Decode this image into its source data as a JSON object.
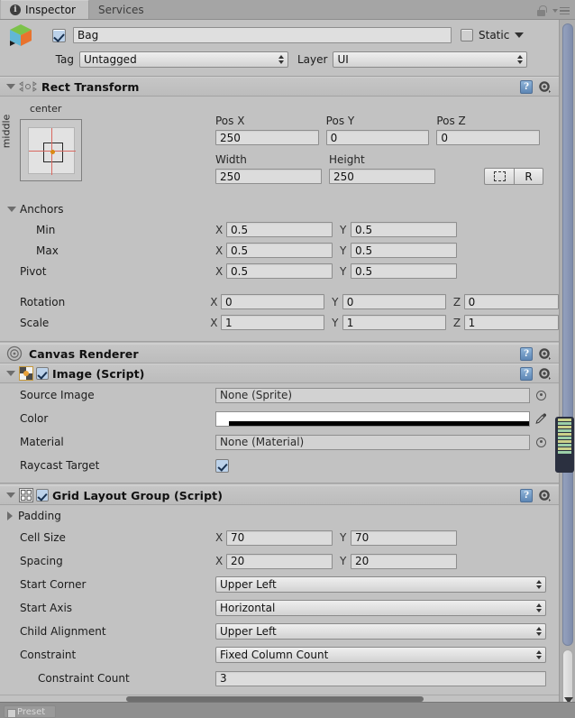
{
  "window": {
    "tabs": [
      {
        "label": "Inspector",
        "icon": "info-icon",
        "active": true
      },
      {
        "label": "Services",
        "icon": "",
        "active": false
      }
    ],
    "lock_icon": "lock-icon",
    "menu_icon": "hamburger-menu-icon"
  },
  "gameobject": {
    "icon": "gameobject-cube-icon",
    "enabled": true,
    "name": "Bag",
    "static_checked": false,
    "static_label": "Static",
    "tag_label": "Tag",
    "tag_value": "Untagged",
    "layer_label": "Layer",
    "layer_value": "UI"
  },
  "rect_transform": {
    "title": "Rect Transform",
    "icon": "rect-transform-icon",
    "expanded": true,
    "anchor_preset_h": "center",
    "anchor_preset_v": "middle",
    "pos_x_label": "Pos X",
    "pos_y_label": "Pos Y",
    "pos_z_label": "Pos Z",
    "pos_x": "250",
    "pos_y": "0",
    "pos_z": "0",
    "width_label": "Width",
    "height_label": "Height",
    "width": "250",
    "height": "250",
    "blueprint_button": "blueprint-icon",
    "raw_button": "R",
    "anchors_label": "Anchors",
    "min_label": "Min",
    "max_label": "Max",
    "pivot_label": "Pivot",
    "rotation_label": "Rotation",
    "scale_label": "Scale",
    "axis_x": "X",
    "axis_y": "Y",
    "axis_z": "Z",
    "anchor_min_x": "0.5",
    "anchor_min_y": "0.5",
    "anchor_max_x": "0.5",
    "anchor_max_y": "0.5",
    "pivot_x": "0.5",
    "pivot_y": "0.5",
    "rotation_x": "0",
    "rotation_y": "0",
    "rotation_z": "0",
    "scale_x": "1",
    "scale_y": "1",
    "scale_z": "1",
    "help_icon": "?",
    "gear_icon": "gear-icon"
  },
  "canvas_renderer": {
    "title": "Canvas Renderer",
    "icon": "canvas-renderer-icon",
    "help_icon": "?",
    "gear_icon": "gear-icon"
  },
  "image": {
    "title": "Image (Script)",
    "icon": "image-script-icon",
    "enabled": true,
    "expanded": true,
    "help_icon": "?",
    "gear_icon": "gear-icon",
    "fields": [
      {
        "label": "Source Image",
        "value": "None (Sprite)",
        "kind": "object"
      },
      {
        "label": "Color",
        "value": "#FFFFFF",
        "kind": "color"
      },
      {
        "label": "Material",
        "value": "None (Material)",
        "kind": "object"
      },
      {
        "label": "Raycast Target",
        "value": "true",
        "kind": "checkbox"
      }
    ]
  },
  "grid_layout_group": {
    "title": "Grid Layout Group (Script)",
    "icon": "grid-layout-icon",
    "enabled": true,
    "expanded": true,
    "help_icon": "?",
    "gear_icon": "gear-icon",
    "padding_label": "Padding",
    "padding_expanded": false,
    "cell_size_label": "Cell Size",
    "cell_size_x": "70",
    "cell_size_y": "70",
    "spacing_label": "Spacing",
    "spacing_x": "20",
    "spacing_y": "20",
    "axis_x": "X",
    "axis_y": "Y",
    "popups": [
      {
        "label": "Start Corner",
        "value": "Upper Left"
      },
      {
        "label": "Start Axis",
        "value": "Horizontal"
      },
      {
        "label": "Child Alignment",
        "value": "Upper Left"
      },
      {
        "label": "Constraint",
        "value": "Fixed Column Count"
      }
    ],
    "constraint_count_label": "Constraint Count",
    "constraint_count": "3"
  },
  "footer": {
    "preset_label": "Preset"
  },
  "colors": {
    "panel_bg": "#c2c2c2",
    "tab_inactive": "#a5a5a5",
    "field_bg": "#dcdcdc",
    "accent_blue": "#8d9ab8",
    "check_blue": "#bcd2ea"
  }
}
